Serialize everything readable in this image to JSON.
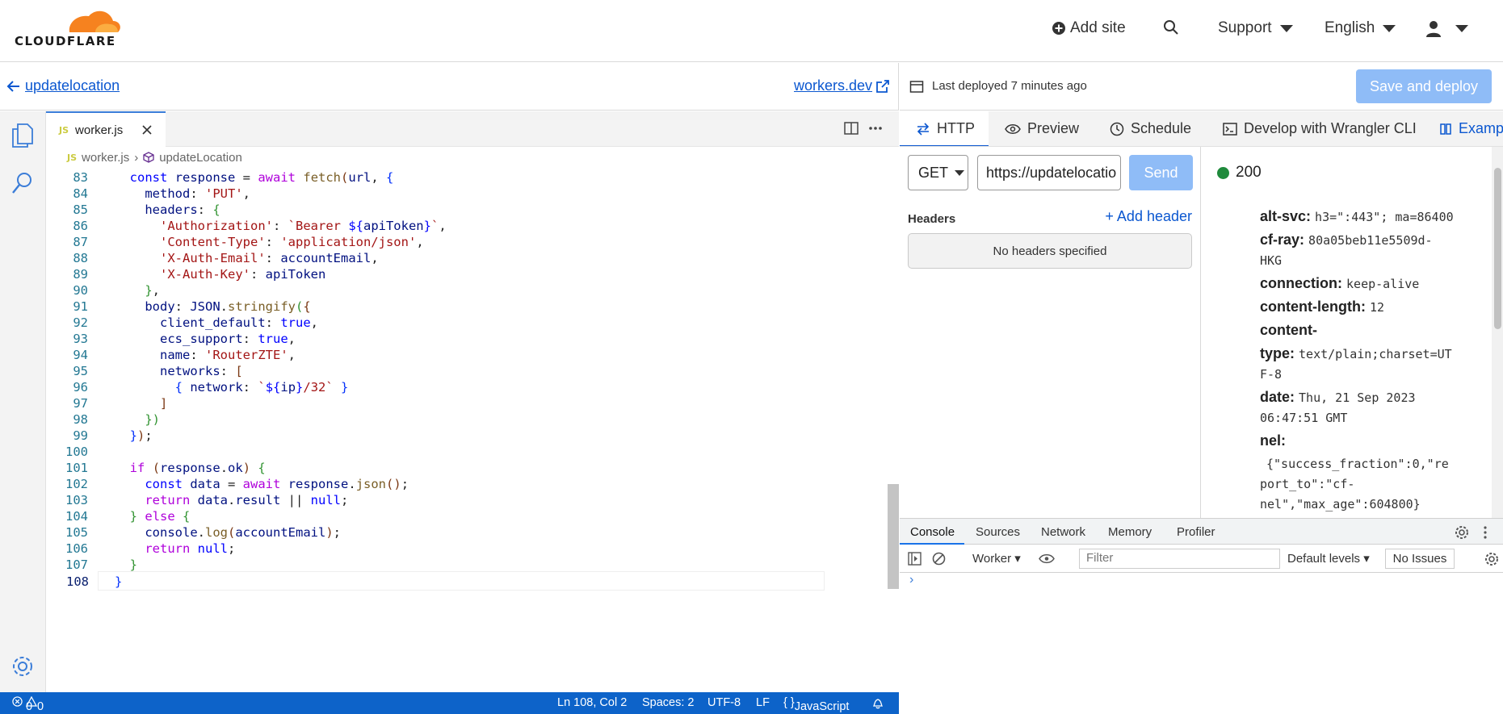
{
  "brand": "CLOUDFLARE",
  "nav": {
    "add_site": "Add site",
    "support": "Support",
    "language": "English"
  },
  "editor_header": {
    "back_link": "updatelocation",
    "workers_link": "workers.dev"
  },
  "deploy": {
    "last_deployed": "Last deployed 7 minutes ago",
    "save_label": "Save and deploy"
  },
  "tab": {
    "badge": "JS",
    "filename": "worker.js"
  },
  "breadcrumb": {
    "file": "worker.js",
    "symbol": "updateLocation"
  },
  "code_lines": [
    83,
    84,
    85,
    86,
    87,
    88,
    89,
    90,
    91,
    92,
    93,
    94,
    95,
    96,
    97,
    98,
    99,
    100,
    101,
    102,
    103,
    104,
    105,
    106,
    107,
    108
  ],
  "status": {
    "errors": "0",
    "warnings": "0",
    "position": "Ln 108, Col 2",
    "spaces": "Spaces: 2",
    "encoding": "UTF-8",
    "eol": "LF",
    "language": "JavaScript"
  },
  "right_tabs": [
    "HTTP",
    "Preview",
    "Schedule",
    "Develop with Wrangler CLI",
    "Exampl"
  ],
  "request": {
    "method": "GET",
    "url": "https://updatelocatio",
    "send": "Send",
    "headers_label": "Headers",
    "add_header": "Add header",
    "no_headers": "No headers specified"
  },
  "response": {
    "status": "200",
    "headers": [
      {
        "k": "alt-svc:",
        "v": "h3=\":443\"; ma=86400"
      },
      {
        "k": "cf-ray:",
        "v": "80a05beb11e5509d-"
      },
      {
        "k": "",
        "v": "HKG"
      },
      {
        "k": "connection:",
        "v": "keep-alive"
      },
      {
        "k": "content-length:",
        "v": "12"
      },
      {
        "k": "content-",
        "v": ""
      },
      {
        "k": "type:",
        "v": "text/plain;charset=UT"
      },
      {
        "k": "",
        "v": "F-8"
      },
      {
        "k": "date:",
        "v": "Thu, 21 Sep 2023"
      },
      {
        "k": "",
        "v": "06:47:51 GMT"
      },
      {
        "k": "nel:",
        "v": ""
      },
      {
        "k": "",
        "v": "{\"success_fraction\":0,\"re"
      },
      {
        "k": "",
        "v": "port_to\":\"cf-"
      },
      {
        "k": "",
        "v": "nel\",\"max_age\":604800}"
      }
    ]
  },
  "devtools": {
    "tabs": [
      "Console",
      "Sources",
      "Network",
      "Memory",
      "Profiler"
    ],
    "context": "Worker",
    "filter_placeholder": "Filter",
    "levels": "Default levels",
    "issues": "No Issues"
  }
}
